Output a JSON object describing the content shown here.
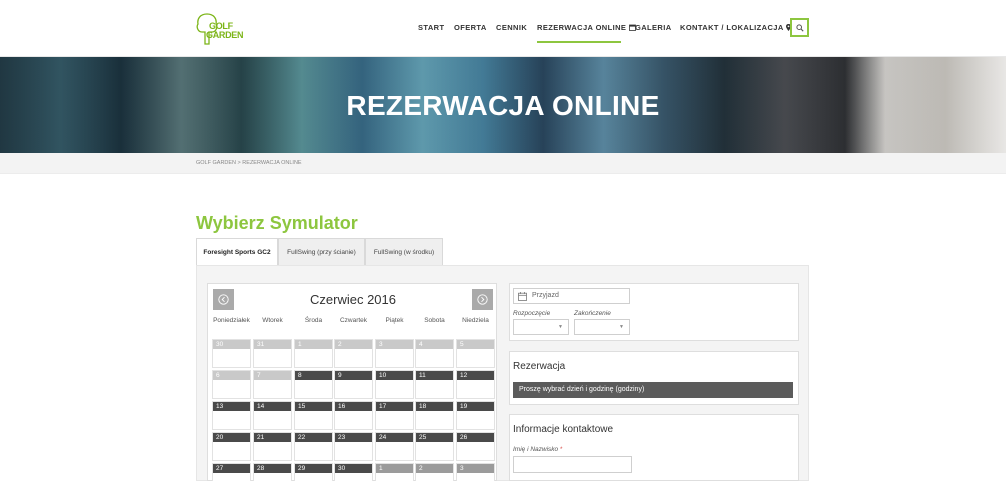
{
  "header": {
    "logo": {
      "line1": "GOLF",
      "line2": "GARDEN"
    },
    "nav": [
      {
        "label": "START"
      },
      {
        "label": "OFERTA"
      },
      {
        "label": "CENNIK"
      },
      {
        "label": "REZERWACJA ONLINE",
        "icon": "calendar-icon",
        "active": true
      },
      {
        "label": "GALERIA"
      },
      {
        "label": "KONTAKT / LOKALIZACJA",
        "icon": "map-pin-icon"
      }
    ],
    "search_icon": "search-icon",
    "accent": "#8dc63f"
  },
  "hero": {
    "title": "REZERWACJA ONLINE"
  },
  "breadcrumb": {
    "text": "GOLF GARDEN > REZERWACJA ONLINE"
  },
  "section": {
    "title": "Wybierz Symulator"
  },
  "tabs": [
    {
      "label": "Foresight Sports GC2",
      "active": true
    },
    {
      "label": "FullSwing (przy ścianie)"
    },
    {
      "label": "FullSwing (w środku)"
    }
  ],
  "calendar": {
    "month": "Czerwiec 2016",
    "days_of_week": [
      "Poniedziałek",
      "Wtorek",
      "Środa",
      "Czwartek",
      "Piątek",
      "Sobota",
      "Niedziela"
    ],
    "weeks": [
      [
        {
          "d": "30",
          "s": "off"
        },
        {
          "d": "31",
          "s": "off"
        },
        {
          "d": "1",
          "s": "off"
        },
        {
          "d": "2",
          "s": "off"
        },
        {
          "d": "3",
          "s": "off"
        },
        {
          "d": "4",
          "s": "off"
        },
        {
          "d": "5",
          "s": "off"
        }
      ],
      [
        {
          "d": "6",
          "s": "off"
        },
        {
          "d": "7",
          "s": "off"
        },
        {
          "d": "8",
          "s": "on"
        },
        {
          "d": "9",
          "s": "on"
        },
        {
          "d": "10",
          "s": "on"
        },
        {
          "d": "11",
          "s": "on"
        },
        {
          "d": "12",
          "s": "on"
        }
      ],
      [
        {
          "d": "13",
          "s": "on"
        },
        {
          "d": "14",
          "s": "on"
        },
        {
          "d": "15",
          "s": "on"
        },
        {
          "d": "16",
          "s": "on"
        },
        {
          "d": "17",
          "s": "on"
        },
        {
          "d": "18",
          "s": "on"
        },
        {
          "d": "19",
          "s": "on"
        }
      ],
      [
        {
          "d": "20",
          "s": "on"
        },
        {
          "d": "21",
          "s": "on"
        },
        {
          "d": "22",
          "s": "on"
        },
        {
          "d": "23",
          "s": "on"
        },
        {
          "d": "24",
          "s": "on"
        },
        {
          "d": "25",
          "s": "on"
        },
        {
          "d": "26",
          "s": "on"
        }
      ],
      [
        {
          "d": "27",
          "s": "on"
        },
        {
          "d": "28",
          "s": "on"
        },
        {
          "d": "29",
          "s": "on"
        },
        {
          "d": "30",
          "s": "on"
        },
        {
          "d": "1",
          "s": "light"
        },
        {
          "d": "2",
          "s": "light"
        },
        {
          "d": "3",
          "s": "light"
        }
      ]
    ]
  },
  "booking": {
    "arrival_placeholder": "Przyjazd",
    "start_label": "Rozpoczęcie",
    "end_label": "Zakończenie",
    "reservation_title": "Rezerwacja",
    "reservation_message": "Proszę wybrać dzień i godzinę (godziny)",
    "contact_title": "Informacje kontaktowe",
    "name_label": "Imię i Nazwisko",
    "required_mark": "*"
  }
}
